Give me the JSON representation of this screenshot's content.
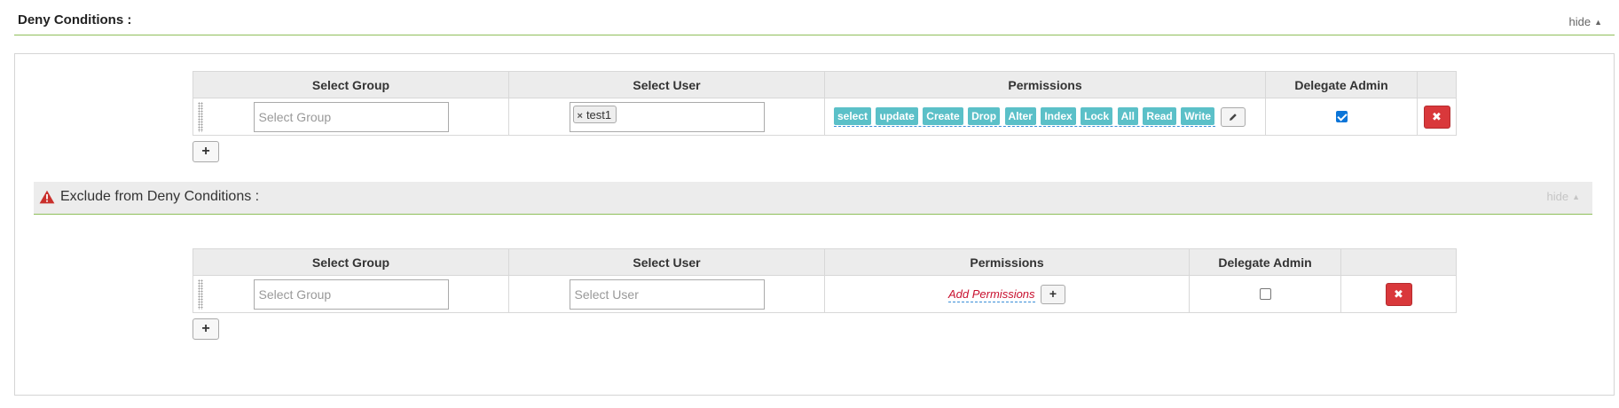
{
  "deny": {
    "title": "Deny Conditions :",
    "hide_label": "hide",
    "columns": [
      "Select Group",
      "Select User",
      "Permissions",
      "Delegate Admin",
      ""
    ],
    "row": {
      "group_placeholder": "Select Group",
      "user_tags": [
        "test1"
      ],
      "permissions": [
        "select",
        "update",
        "Create",
        "Drop",
        "Alter",
        "Index",
        "Lock",
        "All",
        "Read",
        "Write"
      ],
      "delegate_admin_checked": true
    },
    "add_row_label": "+"
  },
  "exclude": {
    "title": "Exclude from Deny Conditions :",
    "hide_label": "hide",
    "columns": [
      "Select Group",
      "Select User",
      "Permissions",
      "Delegate Admin",
      ""
    ],
    "row": {
      "group_placeholder": "Select Group",
      "user_placeholder": "Select User",
      "add_permissions_label": "Add Permissions",
      "delegate_admin_checked": false
    },
    "add_row_label": "+"
  },
  "colors": {
    "accent_line": "#8fbf5a",
    "permission_tag": "#5bc0c8",
    "delete_button": "#d9383b",
    "warning_icon": "#c9302c",
    "add_permissions_link": "#c8102e"
  },
  "icons": {
    "caret": "caret-up-icon",
    "warning": "warning-triangle-icon",
    "edit": "pencil-icon",
    "delete": "close-icon",
    "add": "plus-icon"
  }
}
